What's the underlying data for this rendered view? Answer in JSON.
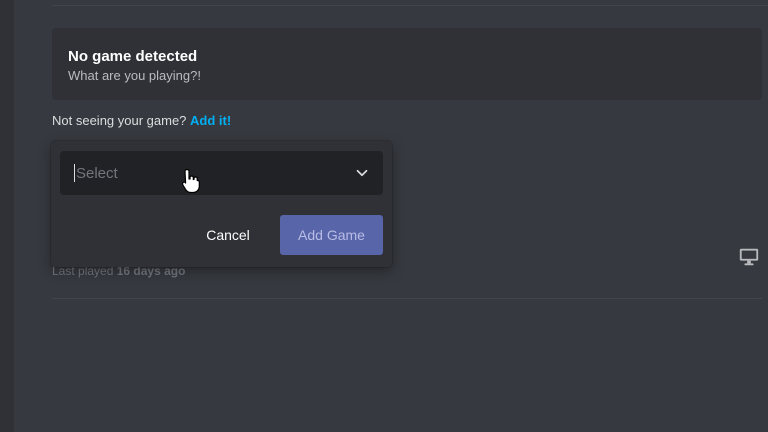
{
  "no_game": {
    "title": "No game detected",
    "subtitle": "What are you playing?!"
  },
  "not_seeing": {
    "text": "Not seeing your game?",
    "link": "Add it!"
  },
  "last_played": {
    "label": "Last played",
    "value": "16 days ago"
  },
  "popout": {
    "select_placeholder": "Select",
    "cancel_label": "Cancel",
    "add_game_label": "Add Game"
  },
  "icons": {
    "chevron": "chevron-down-icon",
    "monitor": "monitor-icon",
    "cursor": "hand-pointer-icon"
  },
  "colors": {
    "background": "#36393f",
    "card": "#2f3136",
    "input": "#202225",
    "link": "#00b0f4",
    "primary_button": "#5865a8"
  }
}
